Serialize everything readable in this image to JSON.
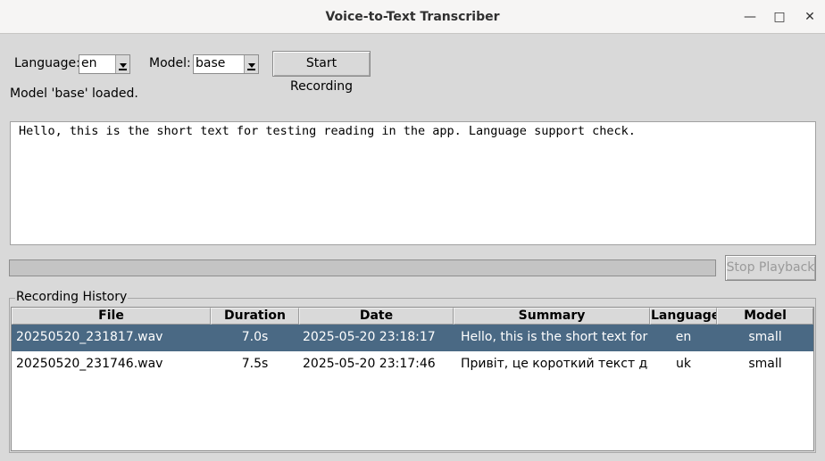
{
  "window": {
    "title": "Voice-to-Text Transcriber",
    "minimize_glyph": "—",
    "maximize_glyph": "□",
    "close_glyph": "✕"
  },
  "toolbar": {
    "language_label": "Language:",
    "language_value": "en",
    "model_label": "Model:",
    "model_value": "base",
    "record_button": "Start Recording"
  },
  "status": "Model 'base' loaded.",
  "transcript": "Hello, this is the short text for testing reading in the app. Language support check.",
  "progress": {
    "value": 0
  },
  "playback": {
    "stop_button": "Stop Playback"
  },
  "history": {
    "label": "Recording History",
    "columns": [
      "File",
      "Duration",
      "Date",
      "Summary",
      "Language",
      "Model"
    ],
    "rows": [
      {
        "file": "20250520_231817.wav",
        "duration": "7.0s",
        "date": "2025-05-20 23:18:17",
        "summary": "Hello, this is the short text for te",
        "language": "en",
        "model": "small",
        "selected": true
      },
      {
        "file": "20250520_231746.wav",
        "duration": "7.5s",
        "date": "2025-05-20 23:17:46",
        "summary": "Привіт, це короткий текст дл",
        "language": "uk",
        "model": "small",
        "selected": false
      }
    ]
  },
  "colors": {
    "selection": "#4a6984",
    "background": "#d9d9d9"
  }
}
